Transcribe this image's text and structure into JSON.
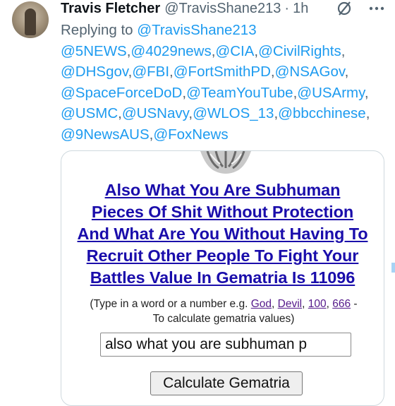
{
  "tweet": {
    "author_name": "Travis Fletcher",
    "author_handle": "@TravisShane213",
    "separator": "·",
    "time": "1h",
    "replying_to_label": "Replying to",
    "replying_to_handle": "@TravisShane213",
    "mentions": [
      "@5NEWS",
      "@4029news",
      "@CIA",
      "@CivilRights",
      "@DHSgov",
      "@FBI",
      "@FortSmithPD",
      "@NSAGov",
      "@SpaceForceDoD",
      "@TeamYouTube",
      "@USArmy",
      "@USMC",
      "@USNavy",
      "@WLOS_13",
      "@bbcchinese",
      "@9NewsAUS",
      "@FoxNews"
    ]
  },
  "card": {
    "result_lines": [
      "Also What You Are Subhuman",
      "Pieces Of Shit Without Protection",
      "And What Are You Without Having To",
      "Recruit Other People To Fight Your",
      "Battles Value In Gematria Is 11096"
    ],
    "hint_prefix": "(Type in a word or a number e.g.",
    "hint_links": [
      "God",
      "Devil",
      "100",
      "666"
    ],
    "hint_suffix": "To calculate gematria values)",
    "input_value": "also what you are subhuman p",
    "calculate_label": "Calculate Gematria"
  },
  "icons": {
    "grok": "grok-icon",
    "more": "more-options-icon",
    "logo": "gematria-logo"
  },
  "colors": {
    "link_blue": "#1d9bf0",
    "result_link": "#1a0dab",
    "visited_link": "#551a8b",
    "secondary_text": "#536471"
  }
}
